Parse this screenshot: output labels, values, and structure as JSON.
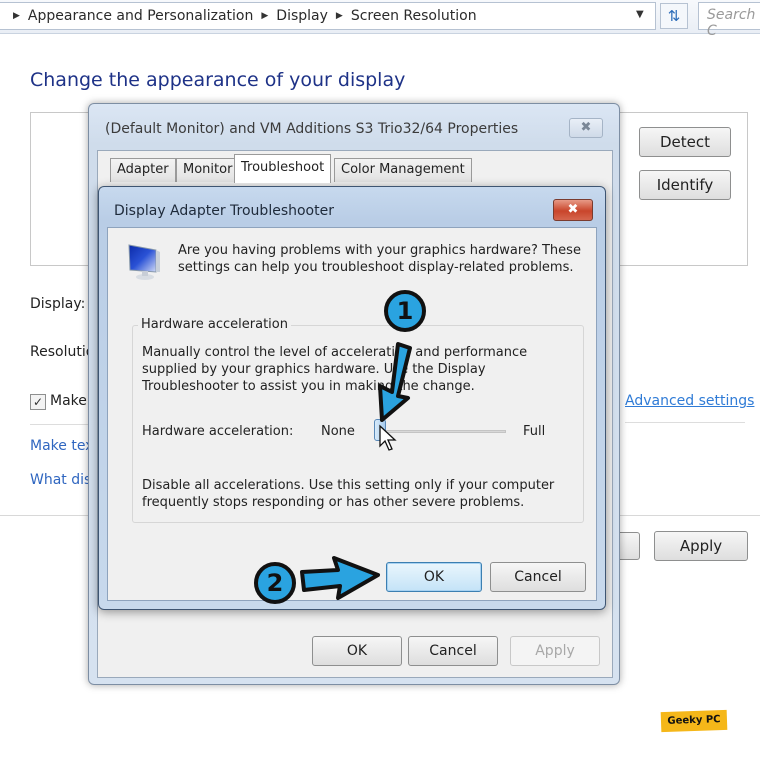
{
  "address_bar": {
    "breadcrumbs": [
      "Appearance and Personalization",
      "Display",
      "Screen Resolution"
    ],
    "search_placeholder": "Search C"
  },
  "background_page": {
    "title": "Change the appearance of your display",
    "detect_label": "Detect",
    "identify_label": "Identify",
    "display_label": "Display:",
    "resolution_label": "Resolutio",
    "make_checkbox_label": "Make",
    "make_checkbox_checked": true,
    "link_make_text": "Make tex",
    "link_what_display": "What dis",
    "advanced_settings_link": "Advanced settings",
    "apply_label": "Apply"
  },
  "properties_window": {
    "title": "(Default Monitor) and VM Additions S3 Trio32/64 Properties",
    "close_icon": "close-icon",
    "tabs": [
      {
        "label": "Adapter",
        "active": false
      },
      {
        "label": "Monitor",
        "active": false
      },
      {
        "label": "Troubleshoot",
        "active": true
      },
      {
        "label": "Color Management",
        "active": false
      }
    ],
    "ok_label": "OK",
    "cancel_label": "Cancel",
    "apply_label": "Apply"
  },
  "troubleshooter_dialog": {
    "title": "Display Adapter Troubleshooter",
    "intro_text": "Are you having problems with your graphics hardware? These settings can help you troubleshoot display-related problems.",
    "group_label": "Hardware acceleration",
    "manual_text": "Manually control the level of acceleration and performance supplied by your graphics hardware. Use the Display Troubleshooter to assist you in making the change.",
    "slider": {
      "label": "Hardware acceleration:",
      "min_label": "None",
      "max_label": "Full",
      "value_fraction": 0.0
    },
    "disable_text": "Disable all accelerations. Use this setting only if your computer frequently stops responding or has other severe problems.",
    "ok_label": "OK",
    "cancel_label": "Cancel"
  },
  "annotations": {
    "step_1": "1",
    "step_2": "2",
    "arrow_color": "#2aa3e0"
  },
  "watermark": "Geeky PC"
}
